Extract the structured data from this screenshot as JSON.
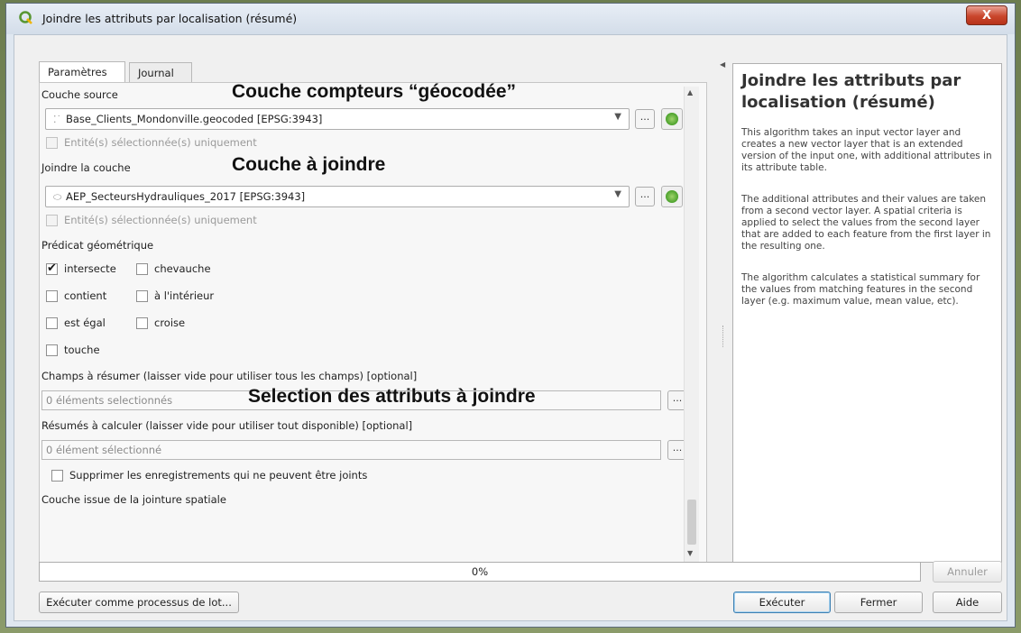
{
  "window": {
    "title": "Joindre les attributs par localisation (résumé)",
    "close_label": "X"
  },
  "tabs": [
    {
      "label": "Paramètres",
      "active": true
    },
    {
      "label": "Journal",
      "active": false
    }
  ],
  "params": {
    "source_label": "Couche source",
    "source_value": "Base_Clients_Mondonville.geocoded [EPSG:3943]",
    "source_selected_only": "Entité(s) sélectionnée(s) uniquement",
    "join_label": "Joindre la couche",
    "join_value": "AEP_SecteursHydrauliques_2017 [EPSG:3943]",
    "join_selected_only": "Entité(s) sélectionnée(s) uniquement",
    "predicate_label": "Prédicat géométrique",
    "predicates": [
      {
        "label": "intersecte",
        "checked": true
      },
      {
        "label": "chevauche",
        "checked": false
      },
      {
        "label": "contient",
        "checked": false
      },
      {
        "label": "à l'intérieur",
        "checked": false
      },
      {
        "label": "est égal",
        "checked": false
      },
      {
        "label": "croise",
        "checked": false
      },
      {
        "label": "touche",
        "checked": false
      }
    ],
    "fields_label": "Champs à résumer (laisser vide pour utiliser tous les champs) [optional]",
    "fields_value": "0 éléments selectionnés",
    "summaries_label": "Résumés à calculer (laisser vide pour utiliser tout disponible) [optional]",
    "summaries_value": "0 élément sélectionné",
    "discard_label": "Supprimer les enregistrements qui ne peuvent être joints",
    "output_label": "Couche issue de la jointure spatiale",
    "ellipsis": "..."
  },
  "annotations": {
    "source": "Couche compteurs “géocodée”",
    "join": "Couche à joindre",
    "fields": "Selection des attributs à joindre"
  },
  "help": {
    "title": "Joindre les attributs par localisation (résumé)",
    "p1": "This algorithm takes an input vector layer and creates a new vector layer that is an extended version of the input one, with additional attributes in its attribute table.",
    "p2": "The additional attributes and their values are taken from a second vector layer. A spatial criteria is applied to select the values from the second layer that are added to each feature from the first layer in the resulting one.",
    "p3": "The algorithm calculates a statistical summary for the values from matching features in the second layer (e.g. maximum value, mean value, etc)."
  },
  "footer": {
    "progress": 0,
    "progress_text": "0%",
    "cancel": "Annuler",
    "batch": "Exécuter comme processus de lot...",
    "run": "Exécuter",
    "close": "Fermer",
    "help": "Aide"
  },
  "colors": {
    "accent_green": "#3f9a23",
    "close_red": "#c9462c"
  }
}
